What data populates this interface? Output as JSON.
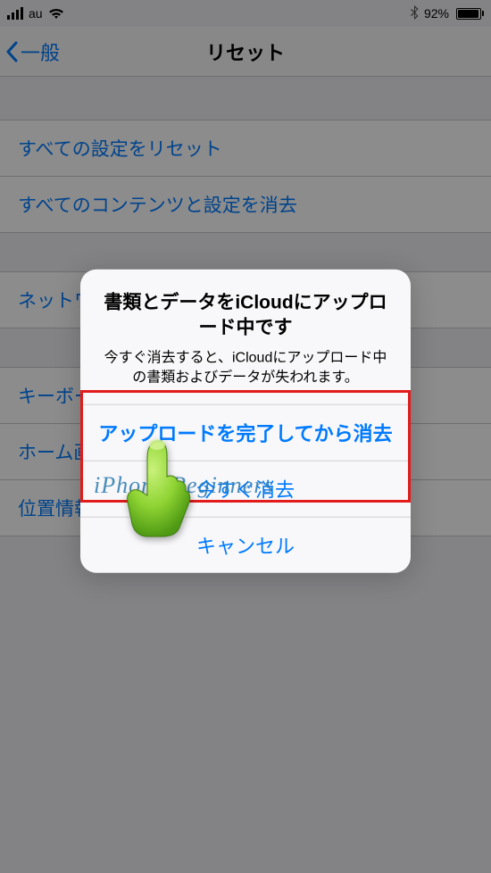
{
  "status": {
    "carrier": "au",
    "bluetooth": "✻",
    "battery_pct": "92%"
  },
  "nav": {
    "back": "一般",
    "title": "リセット"
  },
  "rows": {
    "reset_all": "すべての設定をリセット",
    "erase_all": "すべてのコンテンツと設定を消去",
    "network": "ネットワーク設定をリセット",
    "keyboard": "キーボードの変換学習をリセット",
    "home": "ホーム画面のレイアウトをリセット",
    "location": "位置情報とプライバシーをリセット"
  },
  "alert": {
    "title": "書類とデータをiCloudにアップロード中です",
    "message": "今すぐ消去すると、iCloudにアップロード中の書類およびデータが失われます。",
    "primary": "アップロードを完了してから消去",
    "erase_now": "今すぐ消去",
    "cancel": "キャンセル"
  },
  "watermark": "iPhone Beginners"
}
